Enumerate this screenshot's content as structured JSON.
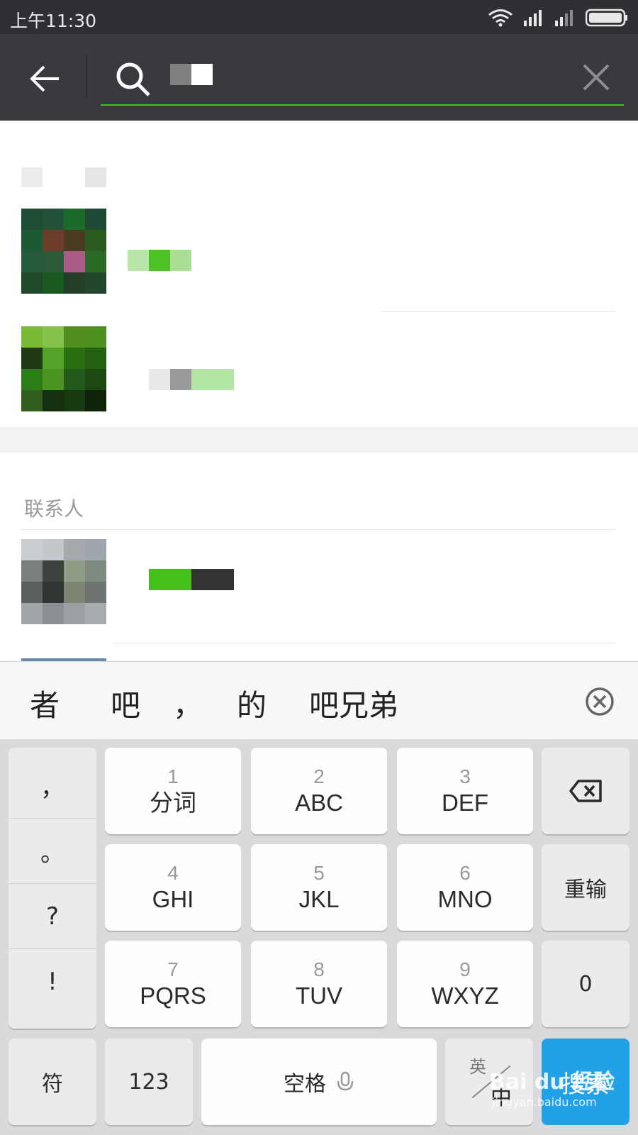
{
  "status_bar": {
    "time": "上午11:30"
  },
  "header": {
    "search_placeholder": ""
  },
  "results": {
    "contacts_section_title": "联系人"
  },
  "candidates": {
    "items": [
      "者",
      "吧",
      "，",
      "的",
      "吧兄弟"
    ]
  },
  "keyboard": {
    "punctuation": [
      "，",
      "。",
      "?",
      "!"
    ],
    "keys": [
      {
        "num": "1",
        "letters": "分词"
      },
      {
        "num": "2",
        "letters": "ABC"
      },
      {
        "num": "3",
        "letters": "DEF"
      },
      {
        "num": "4",
        "letters": "GHI"
      },
      {
        "num": "5",
        "letters": "JKL"
      },
      {
        "num": "6",
        "letters": "MNO"
      },
      {
        "num": "7",
        "letters": "PQRS"
      },
      {
        "num": "8",
        "letters": "TUV"
      },
      {
        "num": "9",
        "letters": "WXYZ"
      }
    ],
    "reinput_label": "重输",
    "zero_label": "0",
    "symbol_label": "符",
    "numeric_label": "123",
    "space_label": "空格",
    "lang_en": "英",
    "lang_zh": "中",
    "search_label": "搜索"
  },
  "watermark": {
    "brand": "Bai du 经验",
    "url": "jingyan.baidu.com"
  },
  "colors": {
    "accent_green": "#45c01a",
    "header_bg": "#393a3f",
    "search_key_blue": "#23a1e6"
  },
  "icons": [
    "wifi-icon",
    "signal-icon",
    "battery-icon",
    "back-arrow-icon",
    "search-icon",
    "clear-icon",
    "candidate-close-icon",
    "backspace-icon",
    "mic-icon"
  ]
}
